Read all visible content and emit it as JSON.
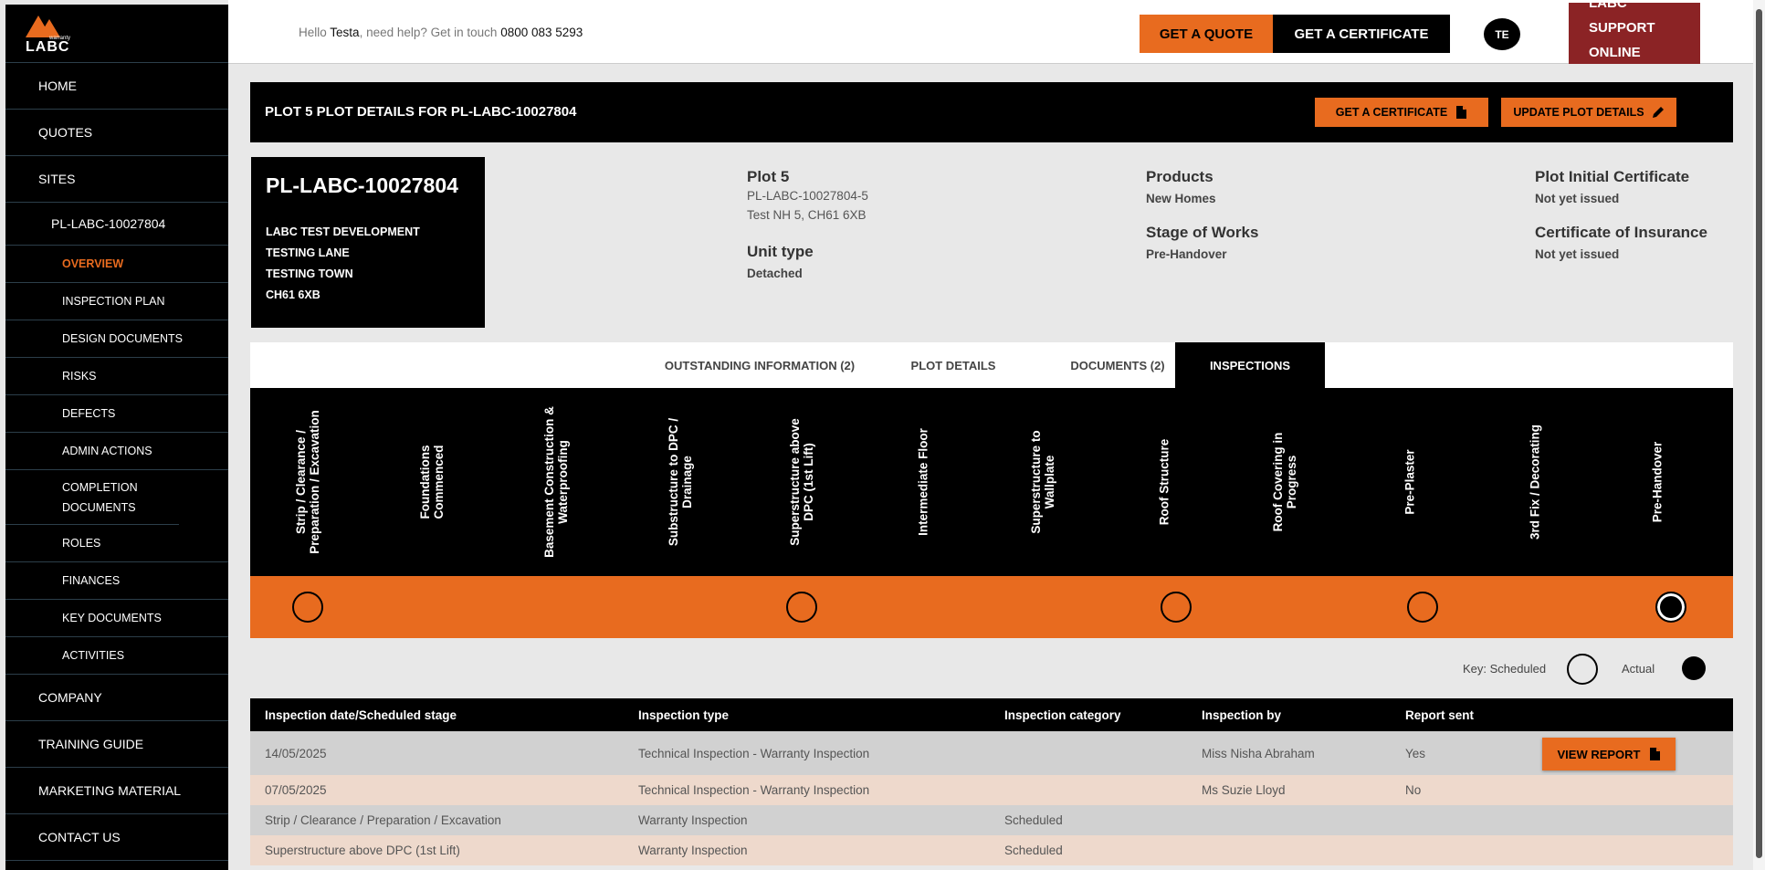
{
  "brand": {
    "logo_word": "LABC",
    "logo_small": "warranty"
  },
  "sidebar": {
    "main_items": [
      "HOME",
      "QUOTES",
      "SITES"
    ],
    "site": "PL-LABC-10027804",
    "sub_items": [
      "OVERVIEW",
      "INSPECTION PLAN",
      "DESIGN DOCUMENTS",
      "RISKS",
      "DEFECTS",
      "ADMIN ACTIONS",
      "COMPLETION DOCUMENTS",
      "ROLES",
      "FINANCES",
      "KEY DOCUMENTS",
      "ACTIVITIES"
    ],
    "bottom_items": [
      "COMPANY",
      "TRAINING GUIDE",
      "MARKETING MATERIAL",
      "CONTACT US"
    ]
  },
  "topbar": {
    "hello_prefix": "Hello ",
    "user": "Testa",
    "help_text": ", need help? Get in touch ",
    "phone": "0800 083 5293",
    "get_quote": "GET A QUOTE",
    "get_certificate": "GET A CERTIFICATE",
    "avatar_initials": "TE",
    "support_lines": [
      "LABC",
      "SUPPORT",
      "ONLINE"
    ]
  },
  "header": {
    "title": "PLOT 5 PLOT DETAILS FOR PL-LABC-10027804",
    "get_certificate": "GET A CERTIFICATE",
    "update_plot": "UPDATE PLOT DETAILS"
  },
  "address_card": {
    "ref": "PL-LABC-10027804",
    "lines": [
      "LABC TEST DEVELOPMENT",
      "TESTING LANE",
      "TESTING TOWN",
      "CH61 6XB"
    ]
  },
  "plot_info": {
    "plot_title": "Plot 5",
    "plot_ref": "PL-LABC-10027804-5",
    "plot_address": "Test NH 5, CH61 6XB",
    "unit_type_label": "Unit type",
    "unit_type": "Detached",
    "products_label": "Products",
    "products": "New Homes",
    "stage_label": "Stage of Works",
    "stage": "Pre-Handover",
    "initial_cert_label": "Plot Initial Certificate",
    "initial_cert": "Not yet issued",
    "insurance_label": "Certificate of Insurance",
    "insurance": "Not yet issued"
  },
  "tabs": [
    "OUTSTANDING INFORMATION (2)",
    "PLOT DETAILS",
    "DOCUMENTS (2)",
    "INSPECTIONS"
  ],
  "active_tab": "INSPECTIONS",
  "stages": [
    {
      "label": "Strip / Clearance / Preparation / Excavation",
      "marker": "scheduled"
    },
    {
      "label": "Foundations Commenced",
      "marker": "none"
    },
    {
      "label": "Basement Construction & Waterproofing",
      "marker": "none"
    },
    {
      "label": "Substructure to DPC / Drainage",
      "marker": "none"
    },
    {
      "label": "Superstructure above DPC (1st Lift)",
      "marker": "scheduled"
    },
    {
      "label": "Intermediate Floor",
      "marker": "none"
    },
    {
      "label": "Superstructure to Wallplate",
      "marker": "none"
    },
    {
      "label": "Roof Structure",
      "marker": "scheduled"
    },
    {
      "label": "Roof Covering in Progress",
      "marker": "none"
    },
    {
      "label": "Pre-Plaster",
      "marker": "scheduled"
    },
    {
      "label": "3rd Fix / Decorating",
      "marker": "none"
    },
    {
      "label": "Pre-Handover",
      "marker": "actual"
    }
  ],
  "key": {
    "scheduled": "Key: Scheduled",
    "actual": "Actual"
  },
  "table": {
    "headers": [
      "Inspection date/Scheduled stage",
      "Inspection type",
      "Inspection category",
      "Inspection by",
      "Report sent"
    ],
    "rows": [
      [
        "14/05/2025",
        "Technical Inspection - Warranty Inspection",
        "",
        "Miss Nisha Abraham",
        "Yes"
      ],
      [
        "07/05/2025",
        "Technical Inspection - Warranty Inspection",
        "",
        "Ms Suzie Lloyd",
        "No"
      ],
      [
        "Strip / Clearance / Preparation / Excavation",
        "Warranty Inspection",
        "Scheduled",
        "",
        ""
      ],
      [
        "Superstructure above DPC (1st Lift)",
        "Warranty Inspection",
        "Scheduled",
        "",
        ""
      ]
    ],
    "view_report": "VIEW REPORT"
  },
  "colors": {
    "accent": "#e86b1f",
    "support": "#8b2325",
    "row_grey": "#d1d1d1",
    "row_peach": "#eed9cc"
  }
}
